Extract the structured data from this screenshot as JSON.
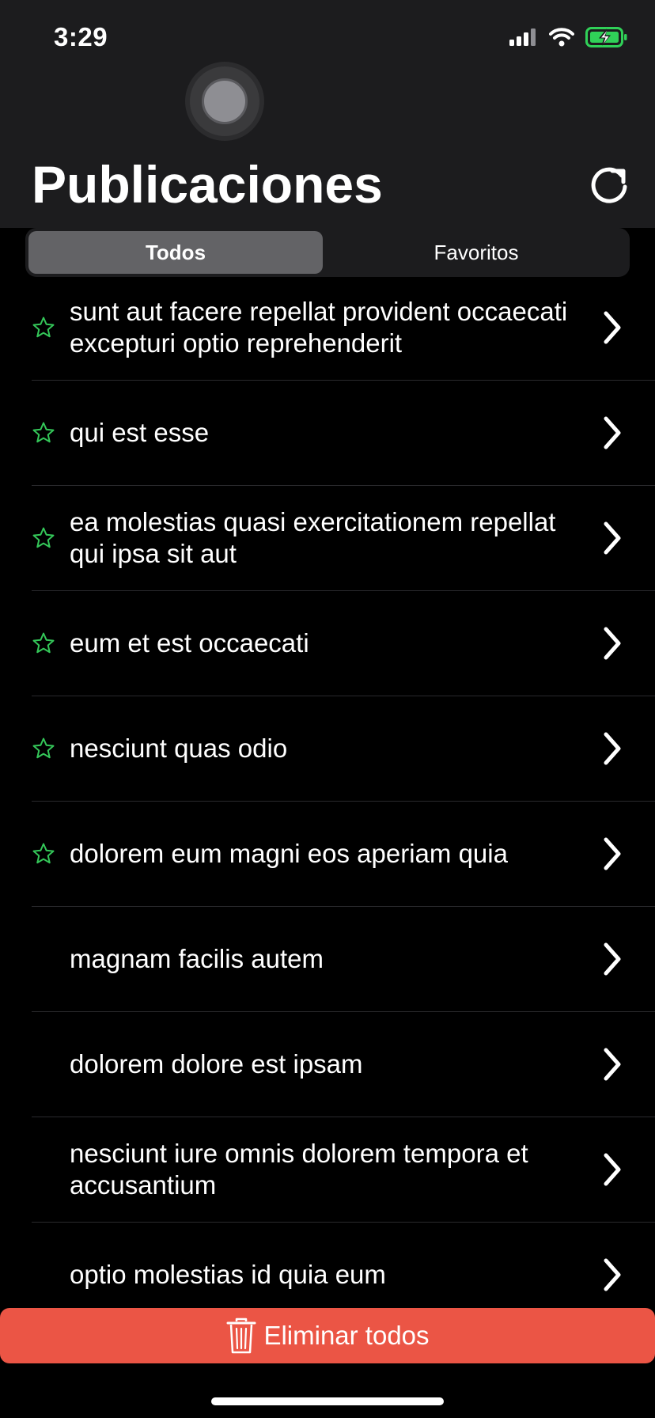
{
  "status": {
    "time": "3:29"
  },
  "header": {
    "title": "Publicaciones"
  },
  "segments": {
    "all": "Todos",
    "favorites": "Favoritos"
  },
  "colors": {
    "accent_green": "#34c759",
    "delete_red": "#eb5545",
    "battery_green": "#30d158"
  },
  "icons": {
    "refresh": "refresh-icon",
    "star": "star-outline-icon",
    "chevron": "chevron-right-icon",
    "trash": "trash-icon"
  },
  "posts": [
    {
      "title": "sunt aut facere repellat provident occaecati excepturi optio reprehenderit",
      "favorite": true
    },
    {
      "title": "qui est esse",
      "favorite": true
    },
    {
      "title": "ea molestias quasi exercitationem repellat qui ipsa sit aut",
      "favorite": true
    },
    {
      "title": "eum et est occaecati",
      "favorite": true
    },
    {
      "title": "nesciunt quas odio",
      "favorite": true
    },
    {
      "title": "dolorem eum magni eos aperiam quia",
      "favorite": true
    },
    {
      "title": "magnam facilis autem",
      "favorite": false
    },
    {
      "title": "dolorem dolore est ipsam",
      "favorite": false
    },
    {
      "title": "nesciunt iure omnis dolorem tempora et accusantium",
      "favorite": false
    },
    {
      "title": "optio molestias id quia eum",
      "favorite": false
    }
  ],
  "footer": {
    "delete_all_label": "Eliminar todos"
  }
}
